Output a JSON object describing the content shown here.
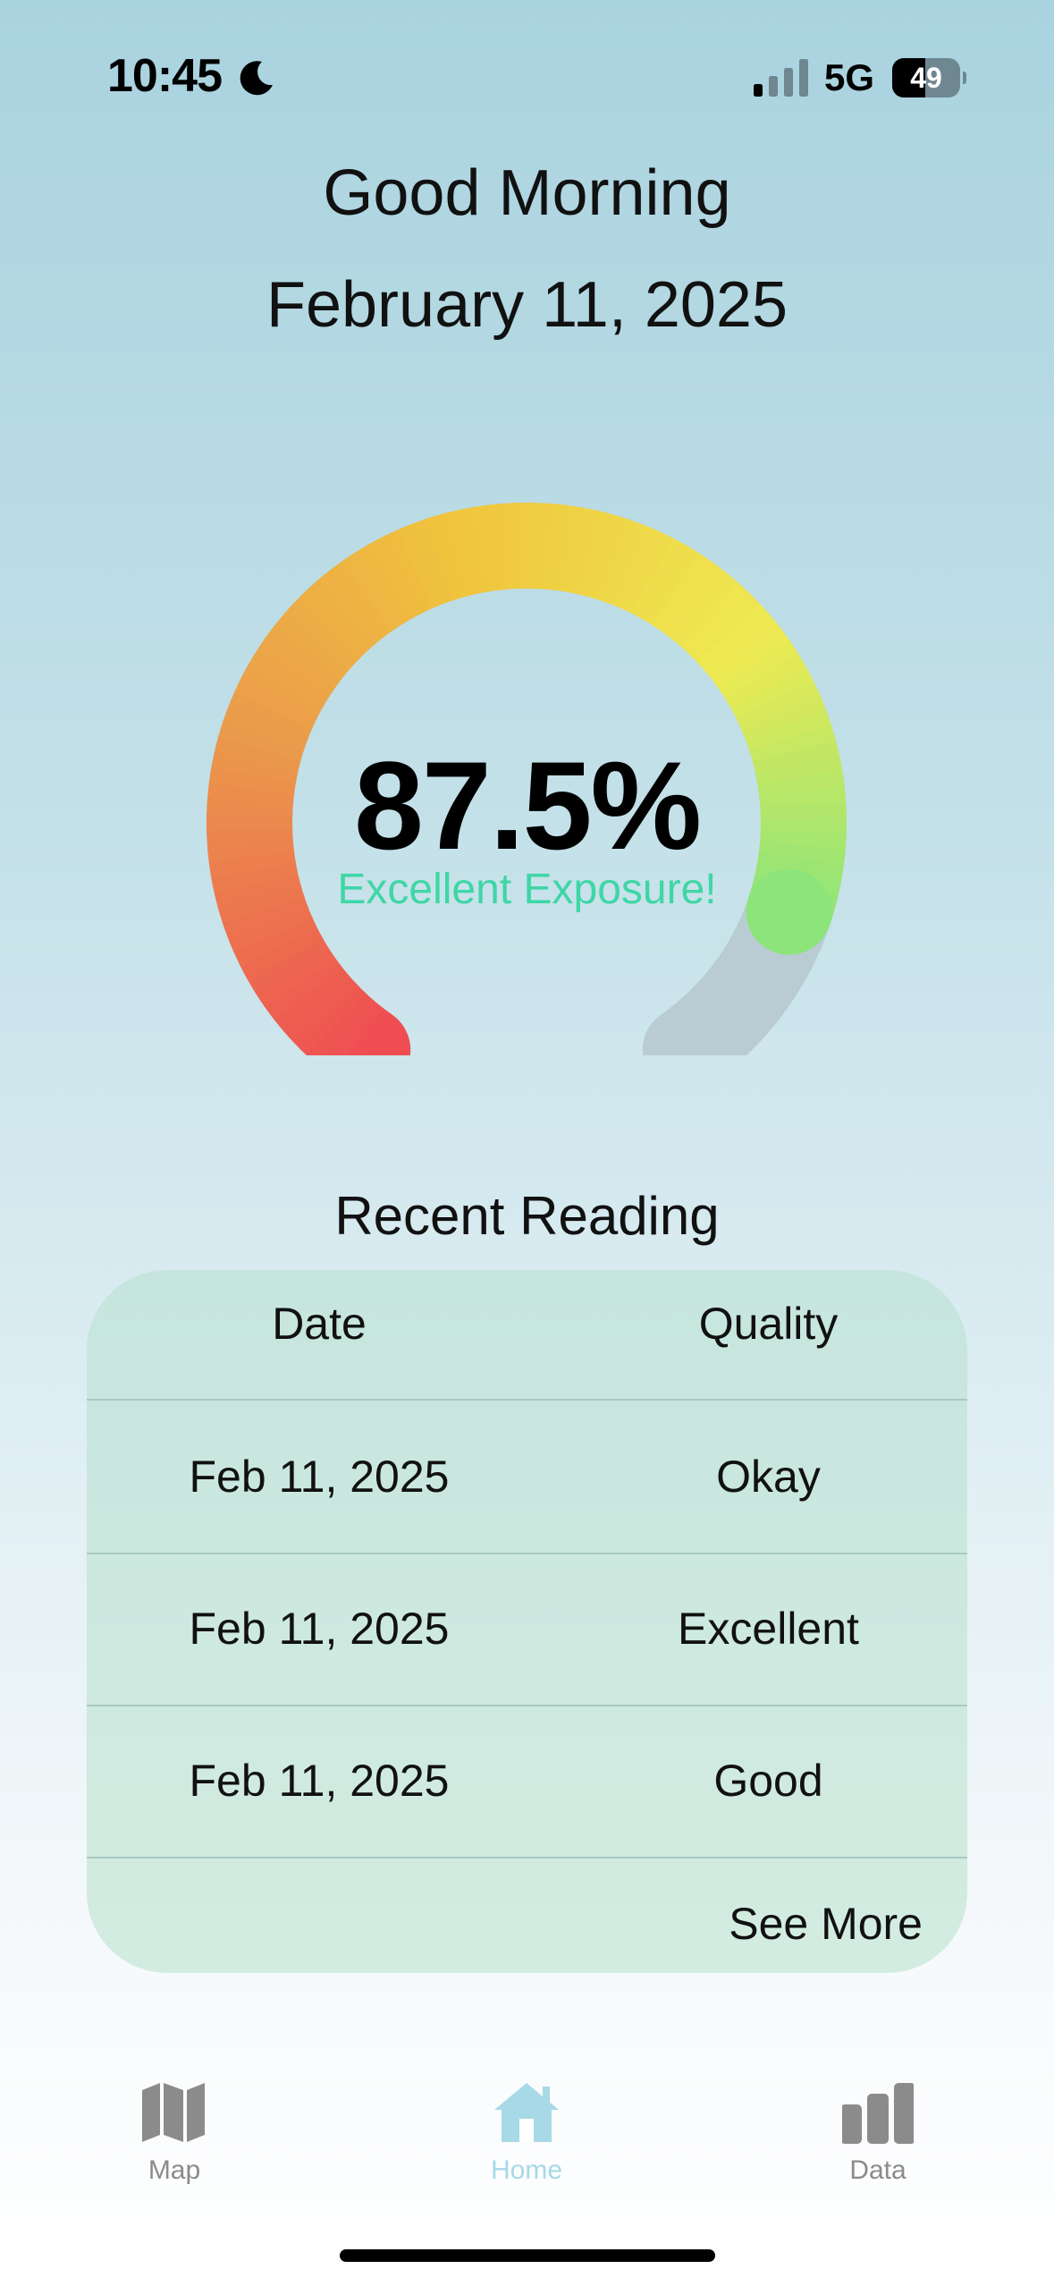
{
  "status_bar": {
    "time": "10:45",
    "network": "5G",
    "battery_level": "49",
    "battery_fraction": 0.49
  },
  "header": {
    "greeting": "Good Morning",
    "date": "February 11, 2025"
  },
  "gauge": {
    "value_text": "87.5%",
    "value": 87.5,
    "max": 100,
    "status_text": "Excellent Exposure!",
    "colors": {
      "start": "#ef4d52",
      "mid_low": "#ea9a4b",
      "mid": "#f0c43d",
      "mid_high": "#eeea52",
      "end": "#8de47a",
      "track": "#b9ccd3",
      "status": "#3fd6a6"
    }
  },
  "recent": {
    "title": "Recent Reading",
    "columns": {
      "date": "Date",
      "quality": "Quality"
    },
    "rows": [
      {
        "date": "Feb 11, 2025",
        "quality": "Okay"
      },
      {
        "date": "Feb 11, 2025",
        "quality": "Excellent"
      },
      {
        "date": "Feb 11, 2025",
        "quality": "Good"
      }
    ],
    "see_more": "See More"
  },
  "tab_bar": {
    "tabs": [
      {
        "label": "Map",
        "icon": "map-icon",
        "active": false
      },
      {
        "label": "Home",
        "icon": "home-icon",
        "active": true
      },
      {
        "label": "Data",
        "icon": "bar-chart-icon",
        "active": false
      }
    ],
    "active_color": "#a7d9e6",
    "inactive_color": "#8b8b8b"
  }
}
